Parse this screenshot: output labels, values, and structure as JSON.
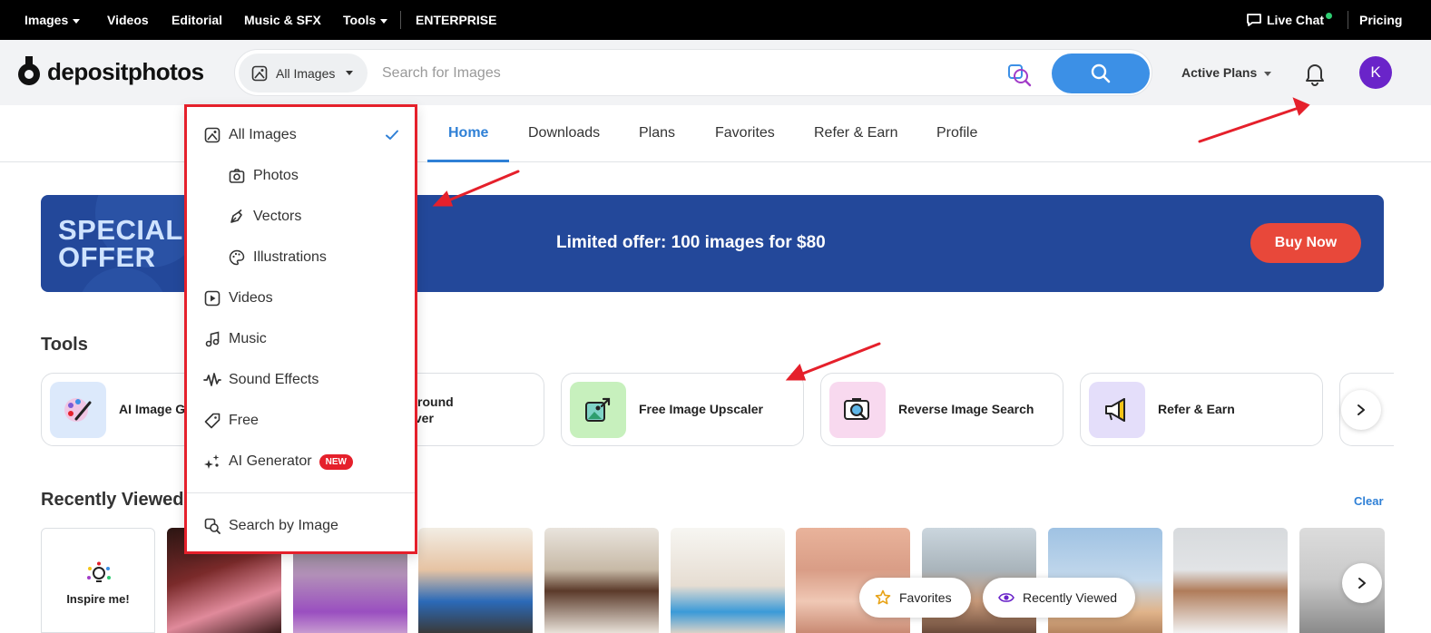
{
  "topbar": {
    "images": "Images",
    "videos": "Videos",
    "editorial": "Editorial",
    "music": "Music & SFX",
    "tools": "Tools",
    "enterprise": "ENTERPRISE",
    "live_chat": "Live Chat",
    "pricing": "Pricing"
  },
  "header": {
    "logo_text": "depositphotos",
    "type_selected": "All Images",
    "search_placeholder": "Search for Images",
    "active_plans": "Active Plans",
    "avatar_initial": "K"
  },
  "tabs": [
    "Home",
    "Downloads",
    "Plans",
    "Favorites",
    "Refer & Earn",
    "Profile"
  ],
  "banner": {
    "special_line1": "SPECIAL",
    "special_line2": "OFFER",
    "text": "Limited offer: 100 images for $80",
    "cta": "Buy Now"
  },
  "tools": {
    "title": "Tools",
    "items": [
      {
        "label": "AI Image Ge",
        "icon": "ai-palette-icon"
      },
      {
        "label": "Background",
        "label2": "Remover",
        "icon": "background-remover-icon"
      },
      {
        "label": "Free Image Upscaler",
        "icon": "upscaler-icon"
      },
      {
        "label": "Reverse Image Search",
        "icon": "reverse-search-icon"
      },
      {
        "label": "Refer & Earn",
        "icon": "megaphone-icon"
      }
    ]
  },
  "recent": {
    "title": "Recently Viewed",
    "clear": "Clear",
    "inspire": "Inspire me!",
    "favorites_pill": "Favorites",
    "recent_pill": "Recently Viewed"
  },
  "dropdown": {
    "items": [
      {
        "label": "All Images",
        "icon": "all-images-icon",
        "selected": true
      },
      {
        "label": "Photos",
        "icon": "camera-icon"
      },
      {
        "label": "Vectors",
        "icon": "pen-icon"
      },
      {
        "label": "Illustrations",
        "icon": "palette-icon"
      },
      {
        "label": "Videos",
        "icon": "play-icon"
      },
      {
        "label": "Music",
        "icon": "music-note-icon"
      },
      {
        "label": "Sound Effects",
        "icon": "waveform-icon"
      },
      {
        "label": "Free",
        "icon": "tag-icon"
      },
      {
        "label": "AI Generator",
        "icon": "sparkles-icon",
        "badge": "NEW"
      },
      {
        "label": "Search by Image",
        "icon": "image-search-icon"
      }
    ]
  },
  "colors": {
    "accent": "#3c90e6",
    "banner": "#23489a",
    "buy": "#e8483a",
    "highlight": "#e5202b",
    "avatar": "#6a24c9"
  }
}
